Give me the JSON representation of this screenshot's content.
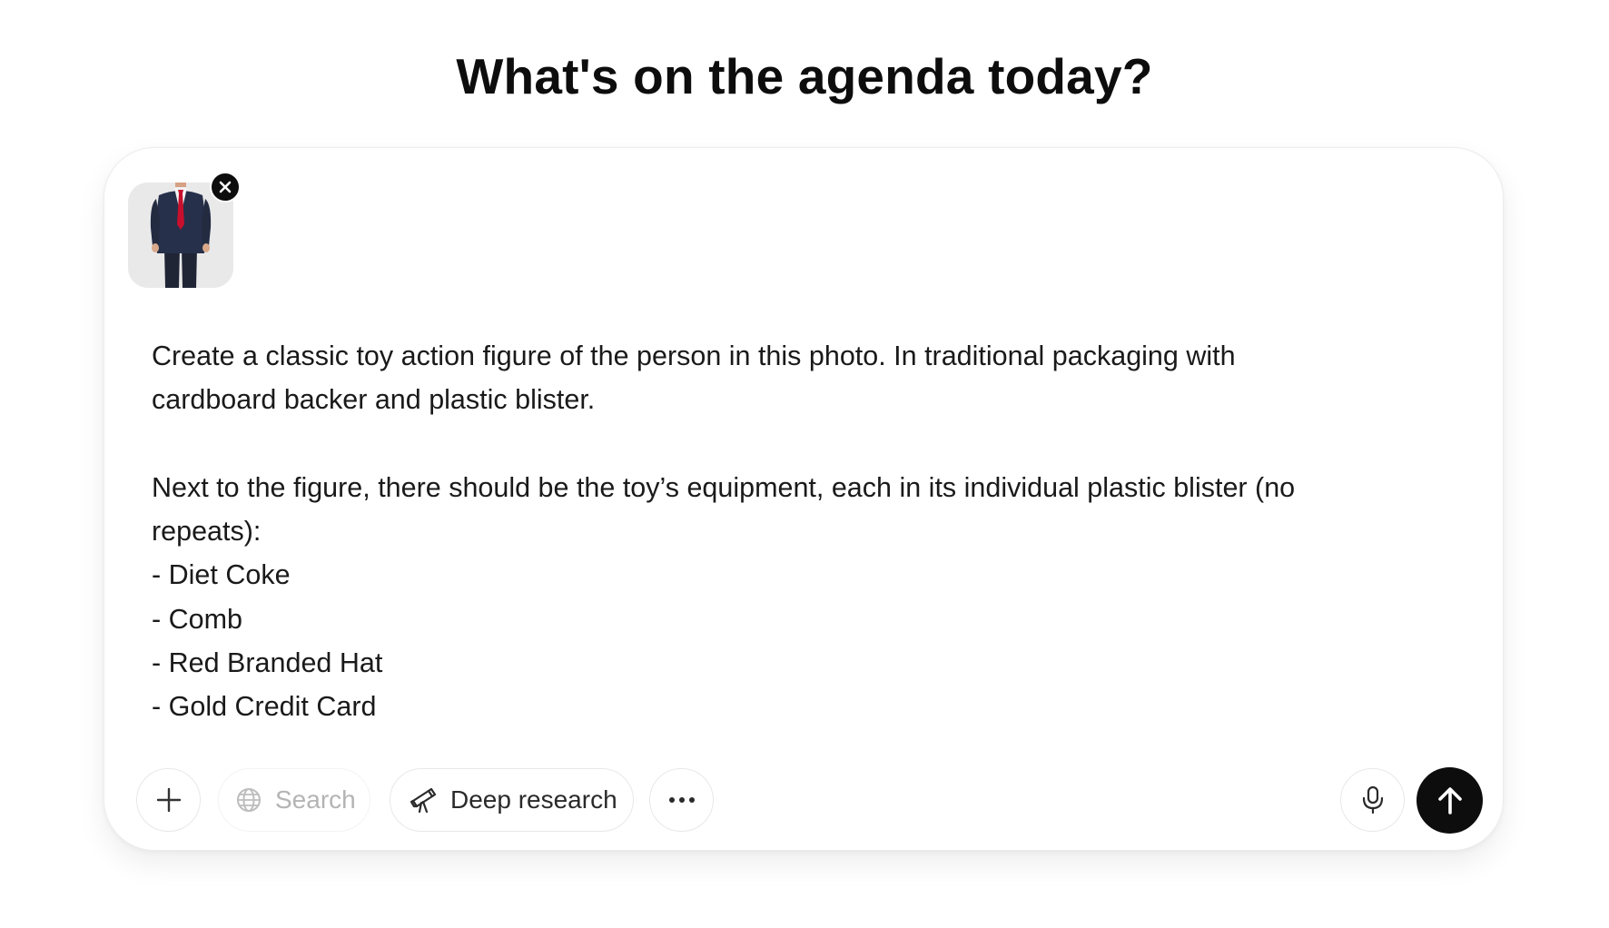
{
  "heading": "What's on the agenda today?",
  "attachment": {
    "icon": "person-in-suit-photo"
  },
  "prompt": {
    "lines": [
      "Create a classic toy action figure of the person in this photo. In traditional packaging with",
      "cardboard backer and plastic blister.",
      "",
      "Next to the figure, there should be the toy’s equipment, each in its individual plastic blister (no",
      "repeats):",
      "- Diet Coke",
      "- Comb",
      "- Red Branded Hat",
      "- Gold Credit Card"
    ]
  },
  "toolbar": {
    "search_label": "Search",
    "deep_research_label": "Deep research"
  },
  "colors": {
    "text": "#0d0d0d",
    "send_button": "#0d0d0d",
    "disabled_text": "#b4b4b4",
    "border": "#e8e8e8"
  }
}
